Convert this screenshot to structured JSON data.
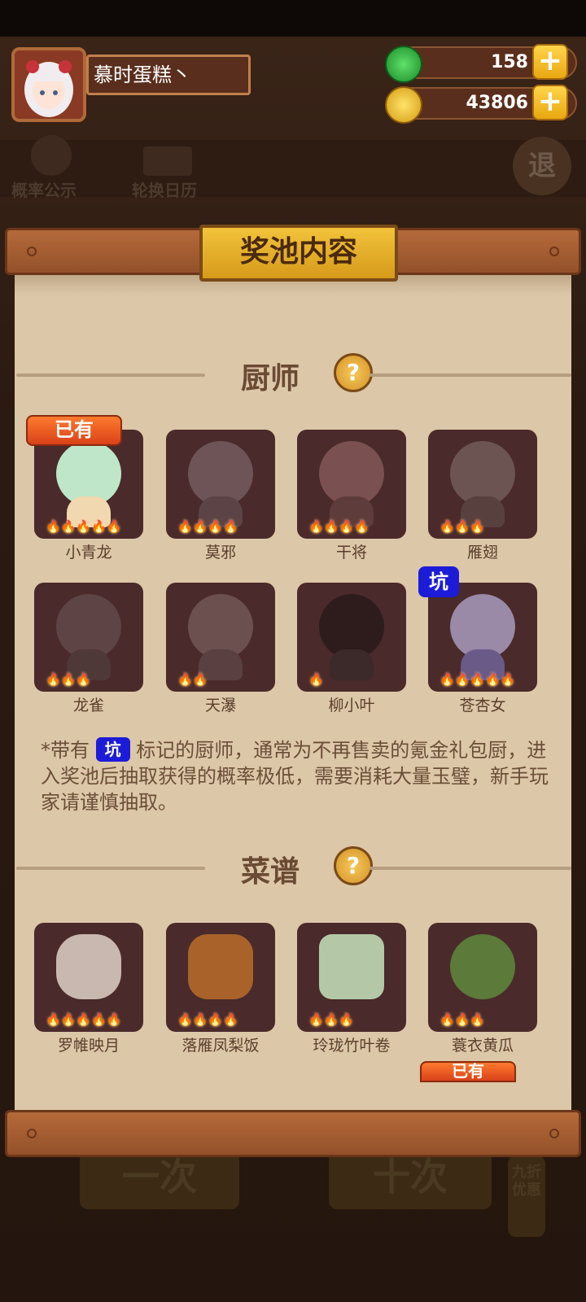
{
  "player": {
    "name": "慕时蛋糕丶"
  },
  "currency": {
    "jade": "158",
    "coins": "43806",
    "plus": "+"
  },
  "top_menu": {
    "probability": "概率公示",
    "calendar": "轮换日历",
    "exit": "退"
  },
  "panel_title": "奖池内容",
  "help_mark": "?",
  "chefs": {
    "heading": "厨师",
    "items": [
      {
        "name": "小青龙",
        "flames": "🔥🔥🔥🔥🔥",
        "tag": "已有"
      },
      {
        "name": "莫邪",
        "flames": "🔥🔥🔥🔥"
      },
      {
        "name": "干将",
        "flames": "🔥🔥🔥🔥"
      },
      {
        "name": "雁翅",
        "flames": "🔥🔥🔥"
      },
      {
        "name": "龙雀",
        "flames": "🔥🔥🔥"
      },
      {
        "name": "天瀑",
        "flames": "🔥🔥"
      },
      {
        "name": "柳小叶",
        "flames": "🔥"
      },
      {
        "name": "苍杏女",
        "flames": "🔥🔥🔥🔥🔥",
        "tag": "坑"
      }
    ]
  },
  "note": {
    "prefix": "*带有",
    "tag": "坑",
    "suffix": "标记的厨师，通常为不再售卖的氪金礼包厨，进入奖池后抽取获得的概率极低，需要消耗大量玉璧，新手玩家请谨慎抽取。"
  },
  "recipes": {
    "heading": "菜谱",
    "items": [
      {
        "name": "罗帷映月",
        "flames": "🔥🔥🔥🔥🔥"
      },
      {
        "name": "落雁凤梨饭",
        "flames": "🔥🔥🔥🔥"
      },
      {
        "name": "玲珑竹叶卷",
        "flames": "🔥🔥🔥"
      },
      {
        "name": "蓑衣黄瓜",
        "flames": "🔥🔥🔥"
      }
    ],
    "next_tag": "已有"
  },
  "bottom": {
    "single": "一次",
    "ten": "十次",
    "discount": "九折优惠"
  },
  "colors": {
    "accent_gold": "#e9b02a",
    "card_bg": "#4a2a2a",
    "owned_tag": "#e8521f",
    "pit_tag": "#1c1cd8"
  }
}
